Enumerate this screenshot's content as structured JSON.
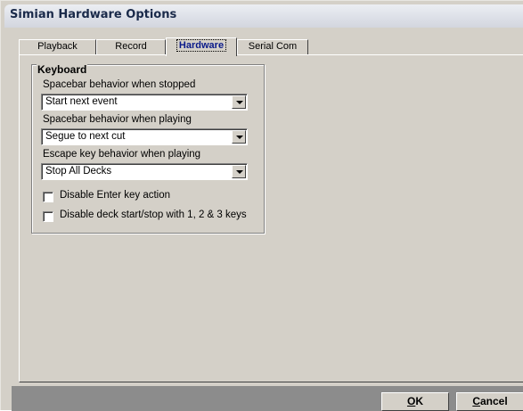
{
  "window": {
    "title": "Simian Hardware Options"
  },
  "tabs": [
    {
      "label": "Playback",
      "active": false
    },
    {
      "label": "Record",
      "active": false
    },
    {
      "label": "Hardware",
      "active": true
    },
    {
      "label": "Serial Com",
      "active": false
    }
  ],
  "keyboard": {
    "legend": "Keyboard",
    "spacebar_stopped": {
      "label": "Spacebar behavior when stopped",
      "value": "Start next event"
    },
    "spacebar_playing": {
      "label": "Spacebar behavior when playing",
      "value": "Segue to next cut"
    },
    "escape_playing": {
      "label": "Escape key behavior when playing",
      "value": "Stop All Decks"
    },
    "checkboxes": [
      {
        "label": "Disable Enter key action",
        "checked": false
      },
      {
        "label": "Disable deck start/stop with 1, 2 & 3 keys",
        "checked": false
      }
    ]
  },
  "buttons": {
    "ok": {
      "accel": "O",
      "rest": "K"
    },
    "cancel": {
      "accel": "C",
      "rest": "ancel"
    }
  },
  "colors": {
    "face": "#d4d0c8",
    "title_text": "#1a2a4a",
    "active_tab_text": "#0a1a8a"
  }
}
